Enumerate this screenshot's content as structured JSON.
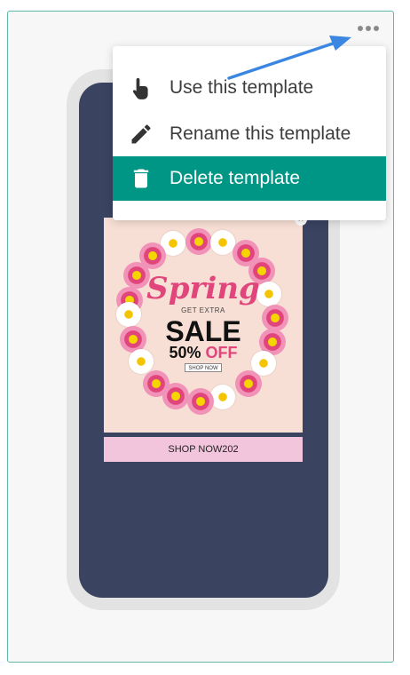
{
  "menu": {
    "items": [
      {
        "label": "Use this template",
        "icon": "hand-pointer-icon"
      },
      {
        "label": "Rename this template",
        "icon": "pencil-icon"
      },
      {
        "label": "Delete template",
        "icon": "trash-icon"
      }
    ]
  },
  "preview": {
    "headline": "Spring",
    "subline": "GET EXTRA",
    "sale": "SALE",
    "discount_value": "50%",
    "discount_word": "OFF",
    "small_button": "SHOP NOW",
    "bottom_bar": "SHOP NOW202"
  },
  "more_button_icon": "more-horizontal-icon",
  "colors": {
    "accent": "#009686",
    "card_border": "#5fb8a8",
    "phone_screen": "#3a4461",
    "annotation_arrow": "#3b86e0",
    "promo_pink": "#e0457b"
  }
}
